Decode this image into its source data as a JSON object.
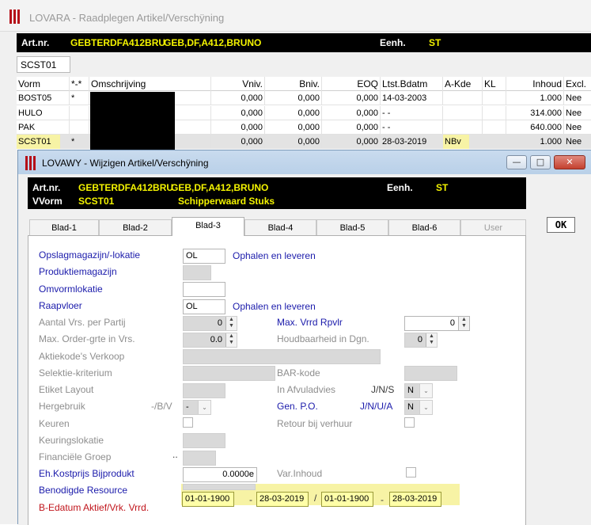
{
  "back_window": {
    "title": "LOVARA - Raadplegen Artikel/Verschÿning",
    "header": {
      "artnr_label": "Art.nr.",
      "artnr_value": "GEBTERDFA412BRU",
      "description": "GEB,DF,A412,BRUNO",
      "eenh_label": "Eenh.",
      "eenh_value": "ST"
    },
    "code_box": "SCST01",
    "grid": {
      "columns": [
        "Vorm",
        "*-*",
        "Omschrijving",
        "Vniv.",
        "Bniv.",
        "EOQ",
        "Ltst.Bdatm",
        "A-Kde",
        "KL",
        "Inhoud",
        "Excl."
      ],
      "rows": [
        {
          "vorm": "BOST05",
          "star": "*",
          "vniv": "0,000",
          "bniv": "0,000",
          "eoq": "0,000",
          "ltst": "14-03-2003",
          "akde": "",
          "kl": "",
          "inhoud": "1.000",
          "excl": "Nee"
        },
        {
          "vorm": "HULO",
          "star": "",
          "vniv": "0,000",
          "bniv": "0,000",
          "eoq": "0,000",
          "ltst": "- -",
          "akde": "",
          "kl": "",
          "inhoud": "314.000",
          "excl": "Nee"
        },
        {
          "vorm": "PAK",
          "star": "",
          "vniv": "0,000",
          "bniv": "0,000",
          "eoq": "0,000",
          "ltst": "- -",
          "akde": "",
          "kl": "",
          "inhoud": "640.000",
          "excl": "Nee"
        },
        {
          "vorm": "SCST01",
          "star": "*",
          "vniv": "0,000",
          "bniv": "0,000",
          "eoq": "0,000",
          "ltst": "28-03-2019",
          "akde": "NBv",
          "kl": "",
          "inhoud": "1.000",
          "excl": "Nee"
        }
      ]
    }
  },
  "dialog": {
    "title": "LOVAWY - Wijzigen Artikel/Verschÿning",
    "header": {
      "artnr_label": "Art.nr.",
      "artnr_value": "GEBTERDFA412BRU",
      "description": "GEB,DF,A412,BRUNO",
      "eenh_label": "Eenh.",
      "eenh_value": "ST",
      "vvorm_label": "VVorm",
      "vvorm_value": "SCST01",
      "vvorm_desc": "Schipperwaard Stuks"
    },
    "ok_label": "OK",
    "tabs": [
      "Blad-1",
      "Blad-2",
      "Blad-3",
      "Blad-4",
      "Blad-5",
      "Blad-6",
      "User"
    ],
    "active_tab": "Blad-3",
    "form": {
      "opslag_label": "Opslagmagazijn/-lokatie",
      "opslag_value": "OL",
      "opslag_desc": "Ophalen en leveren",
      "produktie_label": "Produktiemagazijn",
      "omvorm_label": "Omvormlokatie",
      "raapvloer_label": "Raapvloer",
      "raapvloer_value": "OL",
      "raapvloer_desc": "Ophalen en leveren",
      "aantal_label": "Aantal Vrs. per Partij",
      "aantal_value": "0",
      "maxvrrd_label": "Max. Vrrd Rpvlr",
      "maxvrrd_value": "0",
      "maxorder_label": "Max. Order-grte in Vrs.",
      "maxorder_value": "0.0",
      "houdbaar_label": "Houdbaarheid in Dgn.",
      "houdbaar_value": "0",
      "aktiekode_label": "Aktiekode's Verkoop",
      "selektie_label": "Selektie-kriterium",
      "barkode_label": "BAR-kode",
      "etiket_label": "Etiket Layout",
      "afvul_label": "In Afvuladvies",
      "afvul_opts": "J/N/S",
      "afvul_value": "N",
      "hergebruik_label": "Hergebruik",
      "hergebruik_opts": "-/B/V",
      "hergebruik_value": "-",
      "genpo_label": "Gen. P.O.",
      "genpo_opts": "J/N/U/A",
      "genpo_value": "N",
      "keuren_label": "Keuren",
      "retour_label": "Retour bij verhuur",
      "keuringslok_label": "Keuringslokatie",
      "financiele_label": "Financiële Groep",
      "financiele_dots": "..",
      "kostprijs_label": "Eh.Kostprijs Bijprodukt",
      "kostprijs_value": "0.0000e",
      "varinhoud_label": "Var.Inhoud",
      "resource_label": "Benodigde Resource",
      "bedatum_label": "B-Edatum Aktief/Vrk. Vrrd.",
      "date1": "01-01-1900",
      "date2": "28-03-2019",
      "date3": "01-01-1900",
      "date4": "28-03-2019",
      "dash": "-",
      "slash": "/"
    }
  },
  "colors": {
    "header_bg": "#000000",
    "header_yellow": "#f3f300",
    "label_blue": "#1b1bab",
    "label_red": "#c0141b",
    "highlight_yellow": "#f7f3a5"
  }
}
